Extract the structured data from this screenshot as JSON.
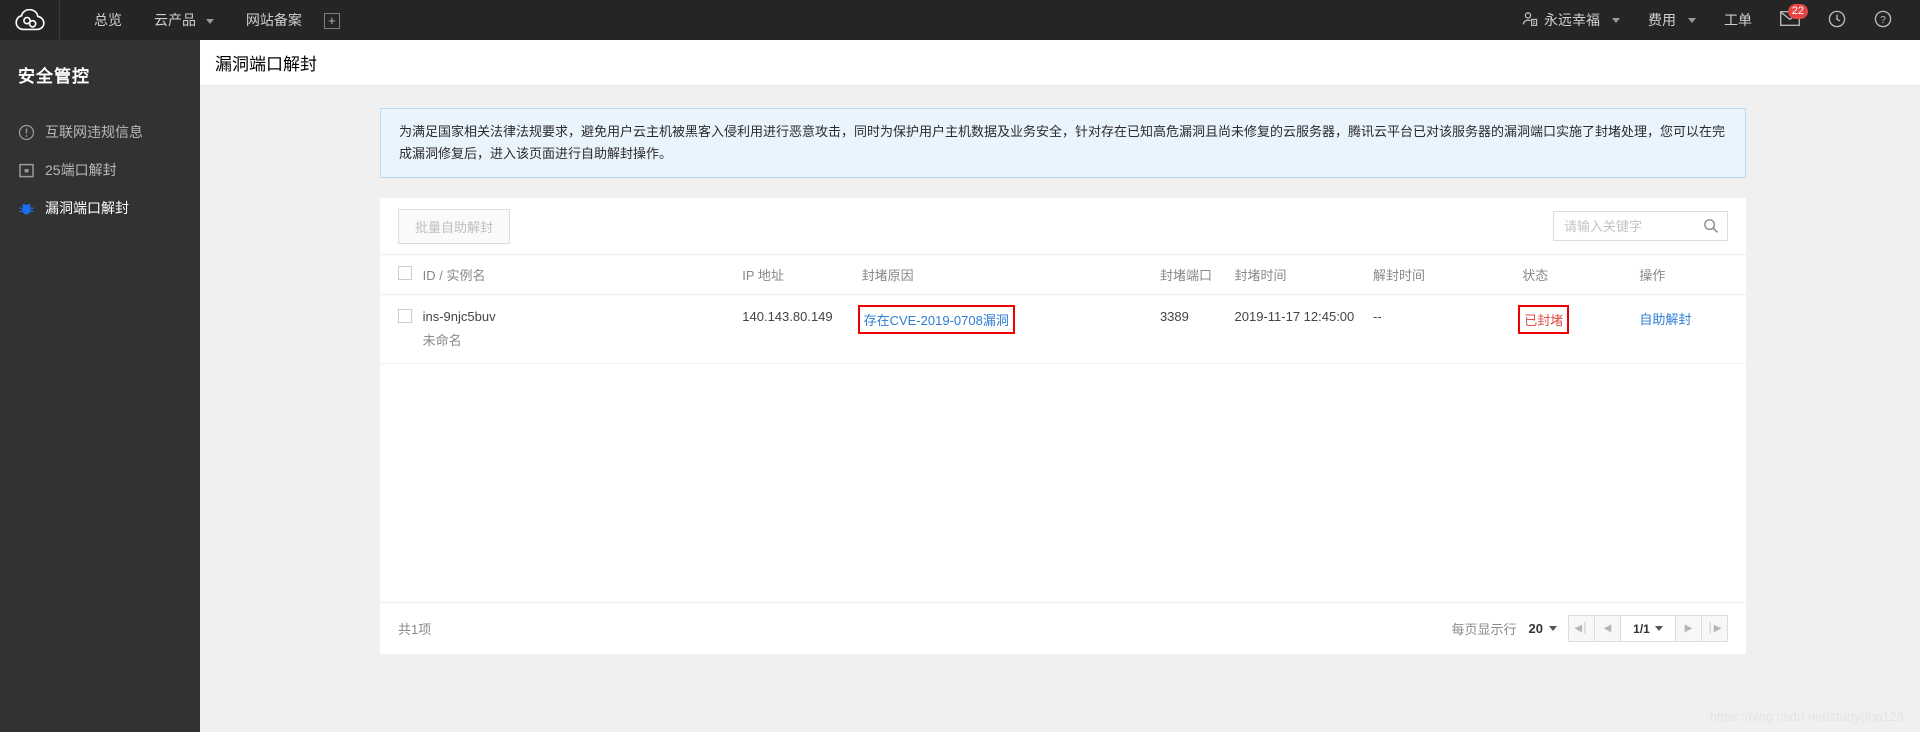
{
  "topbar": {
    "logo_icon": "cloud-logo-icon",
    "nav": [
      {
        "label": "总览",
        "caret": false,
        "name": "nav-overview"
      },
      {
        "label": "云产品",
        "caret": true,
        "name": "nav-cloud-products"
      },
      {
        "label": "网站备案",
        "caret": false,
        "name": "nav-icp-filing"
      }
    ],
    "plus_label": "+",
    "right": [
      {
        "label": "永远幸福",
        "caret": true,
        "icon": "user-icon",
        "name": "account-menu"
      },
      {
        "label": "费用",
        "caret": true,
        "icon": "",
        "name": "billing-menu"
      },
      {
        "label": "工单",
        "caret": false,
        "icon": "",
        "name": "tickets-menu"
      }
    ],
    "message_badge": "22",
    "icons": {
      "mail": "mail-icon",
      "clock": "clock-icon",
      "help": "help-icon"
    }
  },
  "sidebar": {
    "title": "安全管控",
    "items": [
      {
        "label": "互联网违规信息",
        "icon": "exclamation-circle-icon",
        "active": false
      },
      {
        "label": "25端口解封",
        "icon": "mail-square-icon",
        "active": false
      },
      {
        "label": "漏洞端口解封",
        "icon": "bug-icon",
        "active": true
      }
    ]
  },
  "page": {
    "title": "漏洞端口解封",
    "notice": "为满足国家相关法律法规要求，避免用户云主机被黑客入侵利用进行恶意攻击，同时为保护用户主机数据及业务安全，针对存在已知高危漏洞且尚未修复的云服务器，腾讯云平台已对该服务器的漏洞端口实施了封堵处理，您可以在完成漏洞修复后，进入该页面进行自助解封操作。"
  },
  "toolbar": {
    "batch_unblock_label": "批量自助解封",
    "search_placeholder": "请输入关键字",
    "search_value": ""
  },
  "table": {
    "columns": [
      {
        "key": "check",
        "label": ""
      },
      {
        "key": "id",
        "label": "ID / 实例名"
      },
      {
        "key": "ip",
        "label": "IP 地址"
      },
      {
        "key": "reason",
        "label": "封堵原因"
      },
      {
        "key": "port",
        "label": "封堵端口"
      },
      {
        "key": "btime",
        "label": "封堵时间"
      },
      {
        "key": "utime",
        "label": "解封时间"
      },
      {
        "key": "state",
        "label": "状态"
      },
      {
        "key": "op",
        "label": "操作"
      }
    ],
    "rows": [
      {
        "id": "ins-9njc5buv",
        "name": "未命名",
        "ip": "140.143.80.149",
        "reason": "存在CVE-2019-0708漏洞",
        "port": "3389",
        "btime": "2019-11-17 12:45:00",
        "utime": "--",
        "state": "已封堵",
        "op": "自助解封"
      }
    ]
  },
  "footer": {
    "total": "共1项",
    "rows_label": "每页显示行",
    "rows_value": "20",
    "page_value": "1/1"
  },
  "watermark": "https://blog.csdn.net/studyphp123",
  "colors": {
    "topbar_bg": "#252525",
    "sidebar_bg": "#323232",
    "accent_link": "#2d7dd2",
    "danger": "#e1504a",
    "notice_bg": "#eaf4fd",
    "notice_border": "#badaf5",
    "annotation": "#ee0000",
    "badge": "#e54545"
  }
}
